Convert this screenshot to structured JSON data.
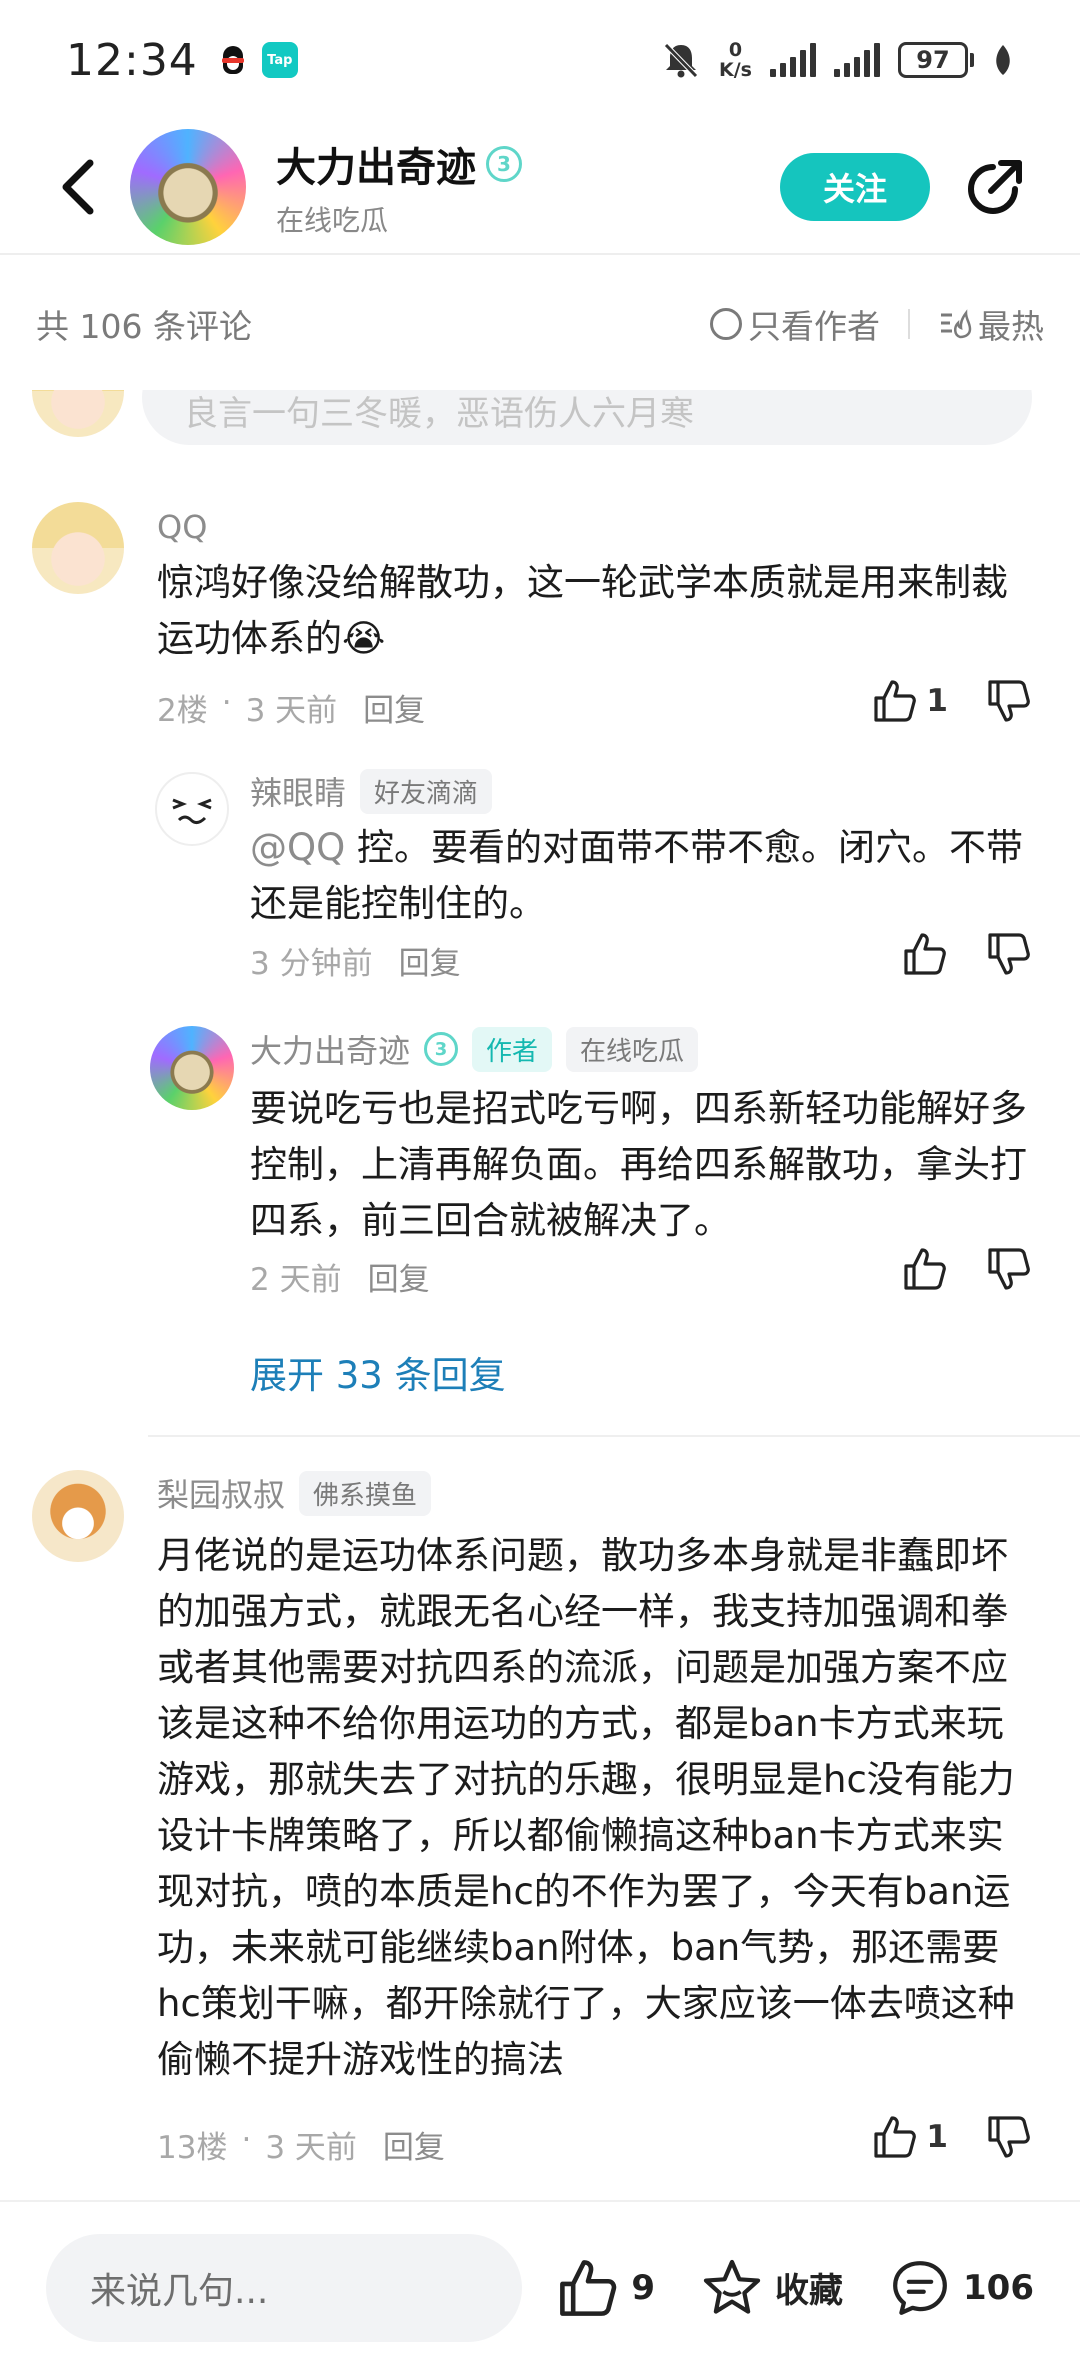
{
  "status_bar": {
    "time": "12:34",
    "app_icon_tap": "Tap",
    "net_speed_value": "0",
    "net_speed_unit": "K/s",
    "battery": "97"
  },
  "header": {
    "author_name": "大力出奇迹",
    "author_level": "3",
    "author_status": "在线吃瓜",
    "follow_label": "关注"
  },
  "filter": {
    "comment_count": "共 106 条评论",
    "only_author": "只看作者",
    "sort_hot": "最热"
  },
  "partial_prompt": "良言一句三冬暖，恶语伤人六月寒",
  "comments": [
    {
      "user": "QQ",
      "text": "惊鸿好像没给解散功，这一轮武学本质就是用来制裁运功体系的😭",
      "floor": "2楼",
      "time": "3 天前",
      "reply_label": "回复",
      "likes": "1",
      "replies": [
        {
          "user": "辣眼睛",
          "tag": "好友滴滴",
          "mention": "@QQ",
          "text": "控。要看的对面带不带不愈。闭穴。不带还是能控制住的。",
          "time": "3 分钟前",
          "reply_label": "回复"
        },
        {
          "user": "大力出奇迹",
          "level": "3",
          "author_tag": "作者",
          "tag": "在线吃瓜",
          "text": "要说吃亏也是招式吃亏啊，四系新轻功能解好多控制，上清再解负面。再给四系解散功，拿头打四系，前三回合就被解决了。",
          "time": "2 天前",
          "reply_label": "回复"
        }
      ],
      "expand_label": "展开 33 条回复"
    },
    {
      "user": "梨园叔叔",
      "tag": "佛系摸鱼",
      "text": "月佬说的是运功体系问题，散功多本身就是非蠢即坏的加强方式，就跟无名心经一样，我支持加强调和拳或者其他需要对抗四系的流派，问题是加强方案不应该是这种不给你用运功的方式，都是ban卡方式来玩游戏，那就失去了对抗的乐趣，很明显是hc没有能力设计卡牌策略了，所以都偷懒搞这种ban卡方式来实现对抗，喷的本质是hc的不作为罢了，今天有ban运功，未来就可能继续ban附体，ban气势，那还需要hc策划干嘛，都开除就行了，大家应该一体去喷这种偷懒不提升游戏性的搞法",
      "floor": "13楼",
      "time": "3 天前",
      "reply_label": "回复",
      "likes": "1"
    }
  ],
  "bottom_bar": {
    "input_placeholder": "来说几句...",
    "like_count": "9",
    "favorite_label": "收藏",
    "comment_count": "106"
  },
  "icons": {
    "back": "back-arrow-icon",
    "share": "share-icon",
    "thumb_up": "thumb-up-icon",
    "thumb_down": "thumb-down-icon",
    "star": "star-icon",
    "comment": "comment-icon"
  },
  "colors": {
    "accent": "#15c5be",
    "link": "#1d7fb8",
    "muted": "#8c8c8c"
  }
}
